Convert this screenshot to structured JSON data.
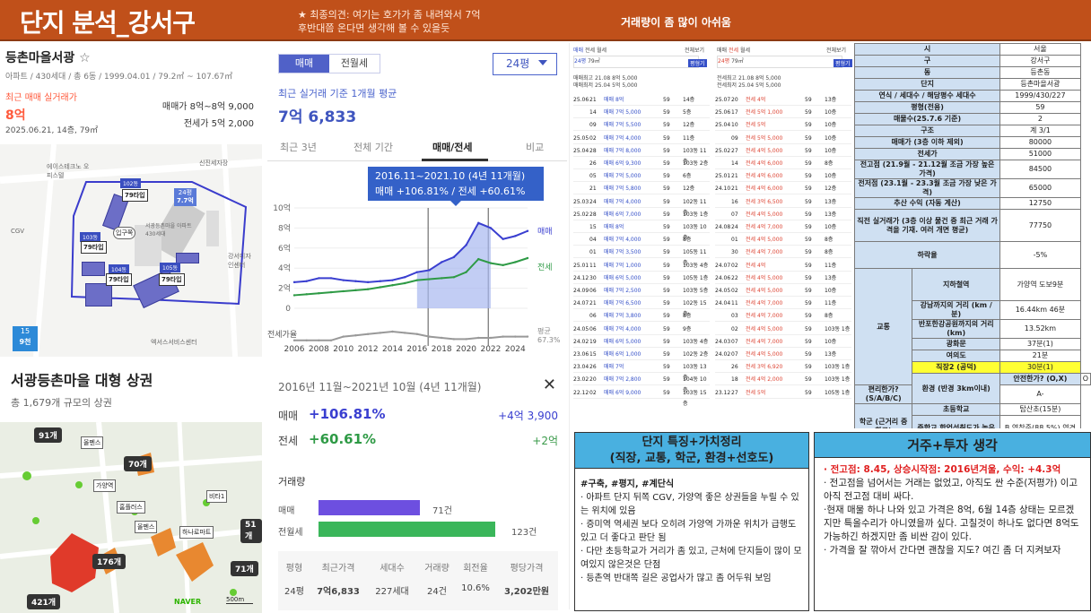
{
  "header": {
    "title": "단지 분석_강서구",
    "comment1": "★ 최종의견: 여기는 호가가 좀 내려와서 7억",
    "comment2": "후반대쯤 온다면 생각해 볼 수 있을듯",
    "summary": "거래량이 좀 많이 아쉬움"
  },
  "complex": {
    "name": "등촌마을서광",
    "star": "☆",
    "info": "아파트 / 430세대 / 총 6동 / 1999.04.01 / 79.2㎡ ~ 107.67㎡",
    "recent_label": "최근 매매 실거래가",
    "recent_price": "8억",
    "recent_date": "2025.06.21, 14층, 79㎡",
    "sale_range": "매매가 8억~8억 9,000",
    "jeonse_range": "전세가 5억 2,000"
  },
  "map1": {
    "poi": [
      "에이스테크노 오피스텔",
      "CGV",
      "신진세자장",
      "서광등촌마을 아파트 430세대",
      "강서디자인센터",
      "엑서스서비스센터"
    ],
    "bldgs": [
      "102동",
      "103동",
      "104동",
      "105동"
    ],
    "types": [
      "79타입",
      "79타입",
      "79타입",
      "79타입"
    ],
    "b24": "24평",
    "b24t": "7.7억",
    "entrance": "입구쪽",
    "unit": "9천",
    "rt": "15"
  },
  "commerce": {
    "title": "서광등촌마을 대형 상권",
    "sub": "총 1,679개 규모의 상권",
    "counts": [
      "91개",
      "70개",
      "51개",
      "176개",
      "71개",
      "421개"
    ],
    "poi": [
      "올펜스",
      "가양역",
      "홈플러스",
      "올펜스",
      "하나로마트",
      "비타1"
    ],
    "naver": "NAVER",
    "scale": "500m"
  },
  "chart": {
    "tabs": [
      "매매",
      "전월세"
    ],
    "size": "24평",
    "avg_label": "최근 실거래 기준 1개월 평균",
    "avg_value": "7억 6,833",
    "periods": [
      "최근 3년",
      "전체 기간",
      "매매/전세",
      "비교"
    ],
    "tip1": "2016.11~2021.10 (4년 11개월)",
    "tip2": "매매 +106.81% / 전세 +60.61%",
    "legend_sale": "매매",
    "legend_jeonse": "전세",
    "legend_ratio": "전세가율",
    "ratio_avg_label": "평균",
    "ratio_avg": "67.3%"
  },
  "chart_data": {
    "type": "line",
    "title": "",
    "x": [
      2006,
      2007,
      2008,
      2009,
      2010,
      2011,
      2012,
      2013,
      2014,
      2015,
      2016,
      2017,
      2018,
      2019,
      2020,
      2021,
      2022,
      2023,
      2024,
      2025
    ],
    "xticks": [
      "2006",
      "2008",
      "2010",
      "2012",
      "2014",
      "2016",
      "2018",
      "2020",
      "2022",
      "2024"
    ],
    "yticks": [
      "10억",
      "8억",
      "6억",
      "4억",
      "2억",
      "0"
    ],
    "ylim": [
      0,
      10
    ],
    "series": [
      {
        "name": "매매",
        "values": [
          2.6,
          2.7,
          3.0,
          3.0,
          2.8,
          2.7,
          2.6,
          2.7,
          2.8,
          3.1,
          3.6,
          3.8,
          4.6,
          5.1,
          6.3,
          8.5,
          8.0,
          6.9,
          7.2,
          7.7
        ]
      },
      {
        "name": "전세",
        "values": [
          1.3,
          1.4,
          1.5,
          1.6,
          1.7,
          1.8,
          1.9,
          2.1,
          2.3,
          2.5,
          2.8,
          2.9,
          3.0,
          3.1,
          3.6,
          4.9,
          4.5,
          4.3,
          4.6,
          5.0
        ]
      },
      {
        "name": "전세가율",
        "values": [
          0.3,
          0.3,
          0.3,
          0.3,
          0.6,
          0.7,
          0.8,
          0.9,
          1.0,
          0.9,
          0.8,
          0.6,
          0.5,
          0.4,
          0.4,
          0.5,
          0.5,
          0.6,
          0.6,
          0.6
        ]
      }
    ]
  },
  "growth": {
    "period": "2016년 11월~2021년 10월 (4년 11개월)",
    "close": "✕",
    "sale_label": "매매",
    "sale_rate": "+106.81%",
    "sale_amount": "+4억 3,900",
    "jeonse_label": "전세",
    "jeonse_rate": "+60.61%",
    "jeonse_amount": "+2억",
    "volume_label": "거래량",
    "vol_sale_label": "매매",
    "vol_sale": "71건",
    "vol_sale_frac": 0.5,
    "vol_rent_label": "전월세",
    "vol_rent": "123건",
    "vol_rent_frac": 0.87,
    "table_headers": [
      "평형",
      "최근가격",
      "세대수",
      "거래량",
      "회전율",
      "평당가격"
    ],
    "table_row": [
      "24평",
      "7억6,833",
      "227세대",
      "24건",
      "10.6%",
      "3,202만원"
    ]
  },
  "trades": {
    "tabs": [
      "매매",
      "전세",
      "월세"
    ],
    "filter": "전체보기",
    "size_label": "24평",
    "size_label2": "79㎡",
    "btn": "평형기",
    "dates_a": "매매최고 21.08 8억 5,000",
    "dates_b": "매매최저 25.04 5억 5,000",
    "dates_c": "전세최고 21.08 8억 5,000",
    "dates_d": "전세최저 25.04 5억 5,000",
    "hdrs": [
      "일",
      "동",
      "계약",
      "가격",
      "층",
      "타입"
    ],
    "left": [
      [
        "25.06",
        "21",
        "매매 8억",
        "59",
        "14층"
      ],
      [
        "",
        "14",
        "매매 7억 5,000",
        "59",
        "5층"
      ],
      [
        "",
        "09",
        "매매 7억 5,500",
        "59",
        "12층"
      ],
      [
        "25.05",
        "02",
        "매매 7억 4,000",
        "59",
        "11층"
      ],
      [
        "25.04",
        "28",
        "매매 7억 8,000",
        "59",
        "103동 11층"
      ],
      [
        "",
        "26",
        "매매 6억 9,300",
        "59",
        "103동 2층"
      ],
      [
        "",
        "05",
        "매매 7억 5,000",
        "59",
        "6층"
      ],
      [
        "",
        "21",
        "매매 7억 5,800",
        "59",
        "12층"
      ],
      [
        "25.03",
        "24",
        "매매 7억 4,000",
        "59",
        "102동 11층"
      ],
      [
        "25.02",
        "28",
        "매매 6억 7,000",
        "59",
        "103동 1층"
      ],
      [
        "",
        "15",
        "매매 8억",
        "59",
        "103동 10층"
      ],
      [
        "",
        "04",
        "매매 7억 4,000",
        "59",
        "8층"
      ],
      [
        "",
        "01",
        "매매 7억 3,500",
        "59",
        "105동 11층"
      ],
      [
        "25.01",
        "11",
        "매매 7억 1,000",
        "59",
        "103동 4층"
      ],
      [
        "24.12",
        "30",
        "매매 6억 5,000",
        "59",
        "105동 1층"
      ],
      [
        "24.09",
        "06",
        "매매 7억 2,500",
        "59",
        "103동 5층"
      ],
      [
        "24.07",
        "21",
        "매매 7억 6,500",
        "59",
        "102동 15층"
      ],
      [
        "",
        "06",
        "매매 7억 3,800",
        "59",
        "8층"
      ],
      [
        "24.05",
        "06",
        "매매 7억 4,000",
        "59",
        "9층"
      ],
      [
        "24.02",
        "19",
        "매매 6억 5,000",
        "59",
        "103동 4층"
      ],
      [
        "23.06",
        "15",
        "매매 6억 1,000",
        "59",
        "102동 2층"
      ],
      [
        "23.04",
        "26",
        "매매 7억",
        "59",
        "103동 13층"
      ],
      [
        "23.02",
        "20",
        "매매 7억 2,800",
        "59",
        "104동 10층"
      ],
      [
        "22.12",
        "02",
        "매매 6억 9,000",
        "59",
        "103동 15층"
      ]
    ],
    "right": [
      [
        "25.07",
        "20",
        "전세 4억",
        "59",
        "13층"
      ],
      [
        "25.06",
        "17",
        "전세 5억 1,000",
        "59",
        "10층"
      ],
      [
        "25.04",
        "10",
        "전세 5억",
        "59",
        "10층"
      ],
      [
        "",
        "09",
        "전세 5억 5,000",
        "59",
        "10층"
      ],
      [
        "25.02",
        "27",
        "전세 4억 5,000",
        "59",
        "10층"
      ],
      [
        "",
        "14",
        "전세 4억 6,000",
        "59",
        "8층"
      ],
      [
        "25.01",
        "21",
        "전세 4억 6,000",
        "59",
        "10층"
      ],
      [
        "24.10",
        "21",
        "전세 4억 6,000",
        "59",
        "12층"
      ],
      [
        "",
        "16",
        "전세 3억 6,500",
        "59",
        "13층"
      ],
      [
        "",
        "07",
        "전세 4억 5,000",
        "59",
        "13층"
      ],
      [
        "24.08",
        "24",
        "전세 4억 7,000",
        "59",
        "10층"
      ],
      [
        "",
        "01",
        "전세 4억 5,000",
        "59",
        "8층"
      ],
      [
        "",
        "30",
        "전세 4억 7,000",
        "59",
        "8층"
      ],
      [
        "24.07",
        "02",
        "전세 4억",
        "59",
        "11층"
      ],
      [
        "24.06",
        "22",
        "전세 4억 5,000",
        "59",
        "13층"
      ],
      [
        "24.05",
        "02",
        "전세 4억 5,000",
        "59",
        "10층"
      ],
      [
        "24.04",
        "11",
        "전세 4억 7,000",
        "59",
        "11층"
      ],
      [
        "",
        "03",
        "전세 4억 7,000",
        "59",
        "8층"
      ],
      [
        "",
        "02",
        "전세 4억 5,000",
        "59",
        "103동 1층"
      ],
      [
        "24.03",
        "07",
        "전세 4억 7,000",
        "59",
        "10층"
      ],
      [
        "24.02",
        "07",
        "전세 4억 5,000",
        "59",
        "13층"
      ],
      [
        "",
        "26",
        "전세 3억 6,920",
        "59",
        "103동 1층"
      ],
      [
        "",
        "18",
        "전세 4억 2,000",
        "59",
        "103동 1층"
      ],
      [
        "23.12",
        "27",
        "전세 5억",
        "59",
        "105동 1층"
      ]
    ]
  },
  "info_table": [
    [
      "시",
      "서울"
    ],
    [
      "구",
      "강서구"
    ],
    [
      "동",
      "등촌동"
    ],
    [
      "단지",
      "등촌마을서광"
    ],
    [
      "연식 / 세대수 / 해당평수 세대수",
      "1999/430/227"
    ],
    [
      "평형(전용)",
      "59"
    ],
    [
      "매물수(25.7.6 기준)",
      "2"
    ],
    [
      "구조",
      "계 3/1"
    ],
    [
      "매매가 (3층 이하 제외)",
      "80000"
    ],
    [
      "전세가",
      "51000"
    ],
    [
      "전고점 (21.9월 - 21.12월 조금 가장 높은 가격)",
      "84500"
    ],
    [
      "전저점 (23.1월 - 23.3월 조금 가장 낮은 가격)",
      "65000"
    ],
    [
      "추산 수익 (자동 계산)",
      "12750"
    ],
    [
      "직전 실거래가 (3층 이상 물건 중 최근 거래 가격을 기재. 여러 개면 평균)",
      "77750"
    ],
    [
      "하락율",
      "-5%"
    ]
  ],
  "info_table2": {
    "transit": "교통",
    "subway": "지하철역",
    "subway_val": "가양역 도보9분",
    "dist1": "강남까지의 거리 (km / 분)",
    "dist1_val": "16.44km 46분",
    "dist2": "반포한강공원까지의 거리 (km)",
    "dist2_val": "13.52km",
    "yeouido1": "광화문",
    "yeouido1_val": "37분(1)",
    "yeouido2": "여의도",
    "yeouido2_val": "21분",
    "jik": "직장2 (공덕)",
    "jik_val": "30분(1)",
    "env": "환경 (반경 3km이내)",
    "safe": "안전한가? (O,X)",
    "safe_val": "O",
    "conv": "편리한가? (S/A/B/C)",
    "conv_val": "A-",
    "school": "학군 (근거리 중학교)",
    "elem": "초등학교",
    "elem_val": "탑산초(15분)",
    "mid": "중학교 학업성취도가 높은가? (S/A/B/C)",
    "mid_val": "B 염창중(88.5%) 염경중(86%)"
  },
  "box1": {
    "title1": "단지 특징+가치정리",
    "title2": "(직장, 교통, 학군, 환경+선호도)",
    "lead": "#구축, #평지, #계단식",
    "items": [
      "· 아파트 단지 뒤쪽 CGV, 가양역 좋은 상권들을 누릴 수 있는 위치에 있음",
      "· 증미역 역세권 보다 오히려 가양역 가까운 위치가 급행도 있고 더 좋다고 판단 됨",
      "· 다만 초등학교가 거리가 좀 있고, 근처에 단지들이 많이 모여있지 않은것은 단점",
      "· 등촌역 반대쪽 길은 공업사가 많고 좀 어두워 보임"
    ]
  },
  "box2": {
    "title": "거주+투자 생각",
    "hi": "· 전고점: 8.45, 상승시작점: 2016년겨울, 수익: +4.3억",
    "items": [
      "· 전고점을 넘어서는 거래는 없었고, 아직도 싼 수준(저평가) 이고 아직 전고점 대비 싸다.",
      "·현재 매물 하나 나와 있고 가격은 8억, 6월 14층 상태는 모르겠지만 특올수리가 아니였을까 싶다. 고칠것이 하나도 없다면 8억도 가능하긴 하겠지만 좀 비싼 감이 있다.",
      "· 가격을 잘 깎아서 간다면 괜찮을 지도? 여긴 좀 더 지켜보자"
    ]
  },
  "colors": {
    "header": "#c0501a",
    "accent": "#3f55bf",
    "sale": "#3a3fd0",
    "jeonse": "#2e9a45",
    "box": "#49b0e0"
  }
}
